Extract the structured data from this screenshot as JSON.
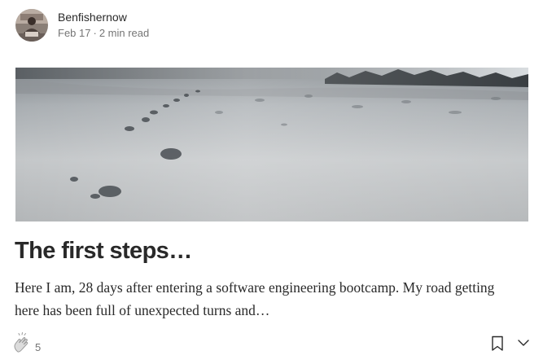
{
  "author": {
    "name": "Benfishernow",
    "date": "Feb 17",
    "separator": "·",
    "read_time": "2 min read"
  },
  "hero_image": {
    "alt": "Footprints in snow"
  },
  "post": {
    "title": "The first steps…",
    "excerpt": "Here I am, 28 days after entering a software engineering bootcamp. My road getting here has been full of unexpected turns and…"
  },
  "footer": {
    "clap_count": "5"
  },
  "icons": {
    "clap": "clap-icon",
    "bookmark": "bookmark-icon",
    "more": "chevron-down-icon"
  },
  "colors": {
    "text": "#292929",
    "muted": "#757575",
    "background": "#ffffff"
  }
}
